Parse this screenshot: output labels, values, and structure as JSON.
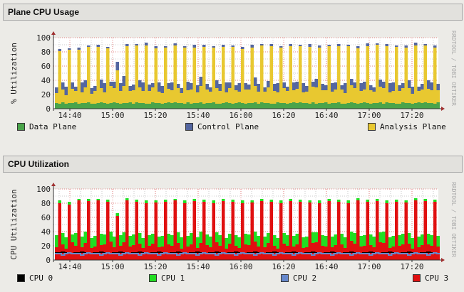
{
  "chart_data": [
    {
      "panel_title": "Plane CPU Usage",
      "type": "area",
      "stacked": true,
      "ylabel": "% Utilization",
      "watermark": "RRDTOOL / TOBI OETIKER",
      "ylim": [
        0,
        100
      ],
      "yticks": [
        "0",
        "20",
        "40",
        "60",
        "80",
        "100"
      ],
      "xticks": [
        "14:40",
        "15:00",
        "15:20",
        "15:40",
        "16:00",
        "16:20",
        "16:40",
        "17:00",
        "17:20"
      ],
      "x_start": "14:33",
      "x_step_minutes": 1.5,
      "grid": true,
      "legend_placement": "bottom",
      "series": [
        {
          "name": "Data Plane",
          "color": "#4aa44a",
          "values": [
            8,
            7,
            9,
            7,
            8,
            8,
            9,
            7,
            8,
            8,
            9,
            7,
            7,
            8,
            9,
            8,
            7,
            8,
            9,
            8,
            7,
            8,
            8,
            9,
            7,
            9,
            8,
            8,
            7,
            7,
            9,
            8,
            8,
            7,
            8,
            9,
            8,
            9,
            8,
            8,
            7,
            9,
            7,
            8,
            8,
            9,
            7,
            8,
            8,
            9,
            7,
            7,
            8,
            9,
            8,
            7,
            8,
            9,
            8,
            7,
            8,
            8,
            9,
            7,
            9,
            8,
            8,
            7,
            7,
            9,
            8,
            8,
            7,
            8,
            9,
            8,
            9,
            8,
            8,
            7,
            9,
            7,
            8,
            8,
            9,
            7,
            8,
            8,
            9,
            7,
            7,
            8,
            9,
            8,
            7,
            8,
            9,
            8,
            7,
            8,
            8,
            9,
            7,
            9,
            8,
            8,
            7,
            7,
            9,
            8,
            8,
            7,
            8,
            9,
            8,
            9,
            8,
            8,
            7,
            9
          ]
        },
        {
          "name": "Analysis Plane",
          "color": "#e8c830",
          "values": [
            14,
            74,
            18,
            12,
            75,
            20,
            16,
            76,
            15,
            22,
            78,
            14,
            18,
            79,
            20,
            15,
            78,
            24,
            20,
            46,
            18,
            24,
            80,
            16,
            19,
            80,
            22,
            17,
            82,
            18,
            21,
            77,
            16,
            15,
            78,
            19,
            18,
            80,
            21,
            14,
            79,
            17,
            20,
            78,
            15,
            23,
            80,
            19,
            16,
            77,
            22,
            18,
            79,
            14,
            21,
            80,
            18,
            15,
            76,
            20,
            19,
            78,
            23,
            17,
            80,
            16,
            22,
            81,
            18,
            14,
            78,
            21,
            18,
            80,
            17,
            20,
            79,
            15,
            16,
            80,
            22,
            23,
            78,
            18,
            17,
            81,
            16,
            19,
            79,
            20,
            15,
            80,
            24,
            21,
            78,
            17,
            18,
            80,
            19,
            16,
            82,
            22,
            22,
            79,
            15,
            17,
            80,
            18,
            20,
            78,
            21,
            14,
            81,
            16,
            19,
            80,
            20,
            18,
            79,
            17
          ]
        },
        {
          "name": "Control Plane",
          "color": "#5466a0",
          "values": [
            8,
            3,
            10,
            12,
            2,
            9,
            6,
            3,
            14,
            10,
            2,
            8,
            7,
            3,
            12,
            13,
            2,
            6,
            9,
            12,
            11,
            14,
            3,
            7,
            8,
            2,
            10,
            12,
            4,
            9,
            6,
            3,
            13,
            10,
            2,
            8,
            11,
            3,
            6,
            7,
            2,
            12,
            9,
            4,
            10,
            13,
            3,
            8,
            6,
            2,
            11,
            10,
            3,
            14,
            8,
            2,
            7,
            12,
            3,
            9,
            7,
            4,
            12,
            11,
            2,
            6,
            9,
            3,
            10,
            13,
            2,
            8,
            6,
            3,
            11,
            10,
            2,
            13,
            8,
            4,
            7,
            12,
            3,
            9,
            7,
            2,
            12,
            10,
            3,
            6,
            14,
            2,
            9,
            8,
            3,
            11,
            11,
            4,
            7,
            6,
            2,
            10,
            9,
            3,
            13,
            12,
            2,
            8,
            7,
            3,
            11,
            10,
            4,
            6,
            8,
            2,
            12,
            11,
            3,
            9
          ]
        }
      ],
      "legend_order": [
        "Data Plane",
        "Control Plane",
        "Analysis Plane"
      ]
    },
    {
      "panel_title": "CPU Utilization",
      "type": "area",
      "stacked": false,
      "ylabel": "CPU Utilization",
      "watermark": "RRDTOOL / TOBI OETIKER",
      "ylim": [
        0,
        100
      ],
      "yticks": [
        "0",
        "20",
        "40",
        "60",
        "80",
        "100"
      ],
      "xticks": [
        "14:40",
        "15:00",
        "15:20",
        "15:40",
        "16:00",
        "16:20",
        "16:40",
        "17:00",
        "17:20"
      ],
      "x_start": "14:33",
      "x_step_minutes": 1.5,
      "grid": true,
      "legend_placement": "bottom",
      "series": [
        {
          "name": "CPU 0",
          "color": "#000000",
          "style": "line",
          "values": [
            10,
            10,
            11,
            10,
            10,
            9,
            10,
            10,
            11,
            10,
            10,
            9,
            10,
            10,
            11,
            10,
            10,
            9,
            10,
            10,
            11,
            10,
            10,
            9,
            10,
            10,
            11,
            10,
            10,
            9,
            10,
            10,
            11,
            10,
            10,
            9,
            10,
            10,
            11,
            10,
            10,
            9,
            10,
            10,
            11,
            10,
            10,
            9,
            10,
            10,
            11,
            10,
            10,
            9,
            10,
            10,
            11,
            10,
            10,
            9,
            10,
            10,
            11,
            10,
            10,
            9,
            10,
            10,
            11,
            10,
            10,
            9,
            10,
            10,
            11,
            10,
            10,
            9,
            10,
            10,
            11,
            10,
            10,
            9,
            10,
            10,
            11,
            10,
            10,
            9,
            10,
            10,
            11,
            10,
            10,
            9,
            10,
            10,
            11,
            10,
            10,
            9,
            10,
            10,
            11,
            10,
            10,
            9,
            10,
            10,
            11,
            10,
            10,
            9,
            10,
            10,
            11,
            10,
            10,
            9
          ]
        },
        {
          "name": "CPU 1",
          "color": "#22dd22",
          "style": "area",
          "values": [
            35,
            84,
            38,
            32,
            82,
            36,
            38,
            86,
            33,
            40,
            86,
            31,
            34,
            86,
            37,
            36,
            85,
            40,
            33,
            66,
            35,
            39,
            87,
            34,
            36,
            85,
            38,
            31,
            84,
            35,
            37,
            84,
            33,
            34,
            85,
            37,
            35,
            86,
            39,
            32,
            84,
            34,
            38,
            86,
            32,
            40,
            85,
            36,
            33,
            84,
            39,
            35,
            86,
            31,
            37,
            85,
            35,
            32,
            84,
            37,
            36,
            84,
            40,
            34,
            86,
            33,
            38,
            85,
            35,
            31,
            84,
            38,
            35,
            86,
            34,
            37,
            85,
            32,
            33,
            84,
            39,
            39,
            84,
            35,
            34,
            86,
            33,
            36,
            85,
            37,
            32,
            84,
            40,
            38,
            87,
            34,
            35,
            85,
            36,
            33,
            86,
            39,
            40,
            84,
            32,
            34,
            85,
            35,
            37,
            84,
            38,
            31,
            87,
            33,
            36,
            86,
            37,
            35,
            85,
            34
          ]
        },
        {
          "name": "CPU 2",
          "color": "#6688cc",
          "style": "line",
          "values": [
            9,
            9,
            7,
            9,
            10,
            9,
            9,
            9,
            7,
            9,
            10,
            9,
            9,
            9,
            7,
            9,
            10,
            9,
            9,
            9,
            7,
            9,
            10,
            9,
            9,
            9,
            7,
            9,
            10,
            9,
            9,
            9,
            7,
            9,
            10,
            9,
            9,
            9,
            7,
            9,
            10,
            9,
            9,
            9,
            7,
            9,
            10,
            9,
            9,
            9,
            7,
            9,
            10,
            9,
            9,
            9,
            7,
            9,
            10,
            9,
            9,
            9,
            7,
            9,
            10,
            9,
            9,
            9,
            7,
            9,
            10,
            9,
            9,
            9,
            7,
            9,
            10,
            9,
            9,
            9,
            7,
            9,
            10,
            9,
            9,
            9,
            7,
            9,
            10,
            9,
            9,
            9,
            7,
            9,
            10,
            9,
            9,
            9,
            7,
            9,
            10,
            9,
            9,
            9,
            7,
            9,
            10,
            9,
            9,
            9,
            7,
            9,
            10,
            9,
            9,
            9,
            7,
            9,
            10,
            9
          ]
        },
        {
          "name": "CPU 3",
          "color": "#e01010",
          "style": "area",
          "values": [
            18,
            80,
            22,
            16,
            78,
            25,
            20,
            84,
            18,
            24,
            83,
            17,
            19,
            84,
            21,
            22,
            82,
            26,
            18,
            62,
            20,
            25,
            84,
            19,
            21,
            82,
            23,
            17,
            80,
            20,
            23,
            81,
            18,
            19,
            82,
            22,
            20,
            84,
            24,
            16,
            80,
            19,
            22,
            83,
            17,
            24,
            82,
            21,
            18,
            80,
            25,
            20,
            83,
            16,
            23,
            82,
            20,
            17,
            80,
            22,
            21,
            81,
            26,
            19,
            83,
            18,
            24,
            82,
            20,
            16,
            80,
            23,
            20,
            83,
            19,
            22,
            82,
            17,
            18,
            81,
            24,
            25,
            80,
            20,
            19,
            83,
            18,
            21,
            82,
            22,
            17,
            80,
            27,
            23,
            84,
            19,
            20,
            82,
            21,
            18,
            83,
            25,
            24,
            80,
            17,
            19,
            82,
            20,
            22,
            81,
            23,
            16,
            84,
            18,
            21,
            83,
            22,
            20,
            82,
            19
          ]
        }
      ],
      "legend_order": [
        "CPU 0",
        "CPU 1",
        "CPU 2",
        "CPU 3"
      ]
    }
  ]
}
